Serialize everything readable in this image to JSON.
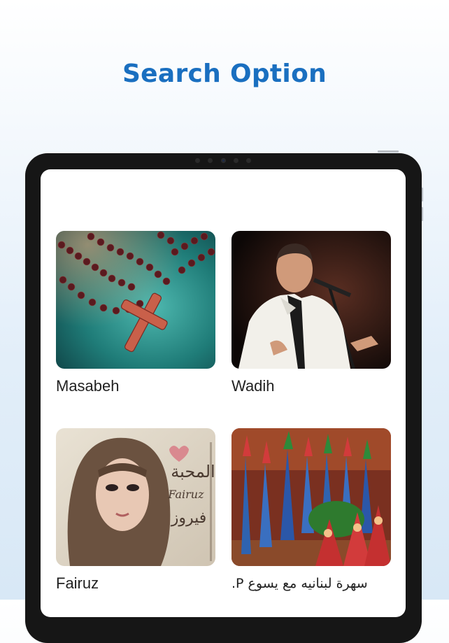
{
  "headline": "Search Option",
  "songs": [
    {
      "title": "Masabeh",
      "image": "rosary-artwork"
    },
    {
      "title": "Wadih",
      "image": "singer-portrait"
    },
    {
      "title": "Fairuz",
      "image": "fairuz-album-cover",
      "cover_text": {
        "arabic_large": "المحبة",
        "latin": "Fairuz",
        "arabic_name": "فيروز"
      }
    },
    {
      "title": "سهرة لبنانيه مع يسوع P.",
      "image": "dabke-dancers"
    }
  ],
  "colors": {
    "headline": "#1a6fc0",
    "device_frame": "#161616",
    "screen": "#ffffff",
    "text": "#222222"
  }
}
